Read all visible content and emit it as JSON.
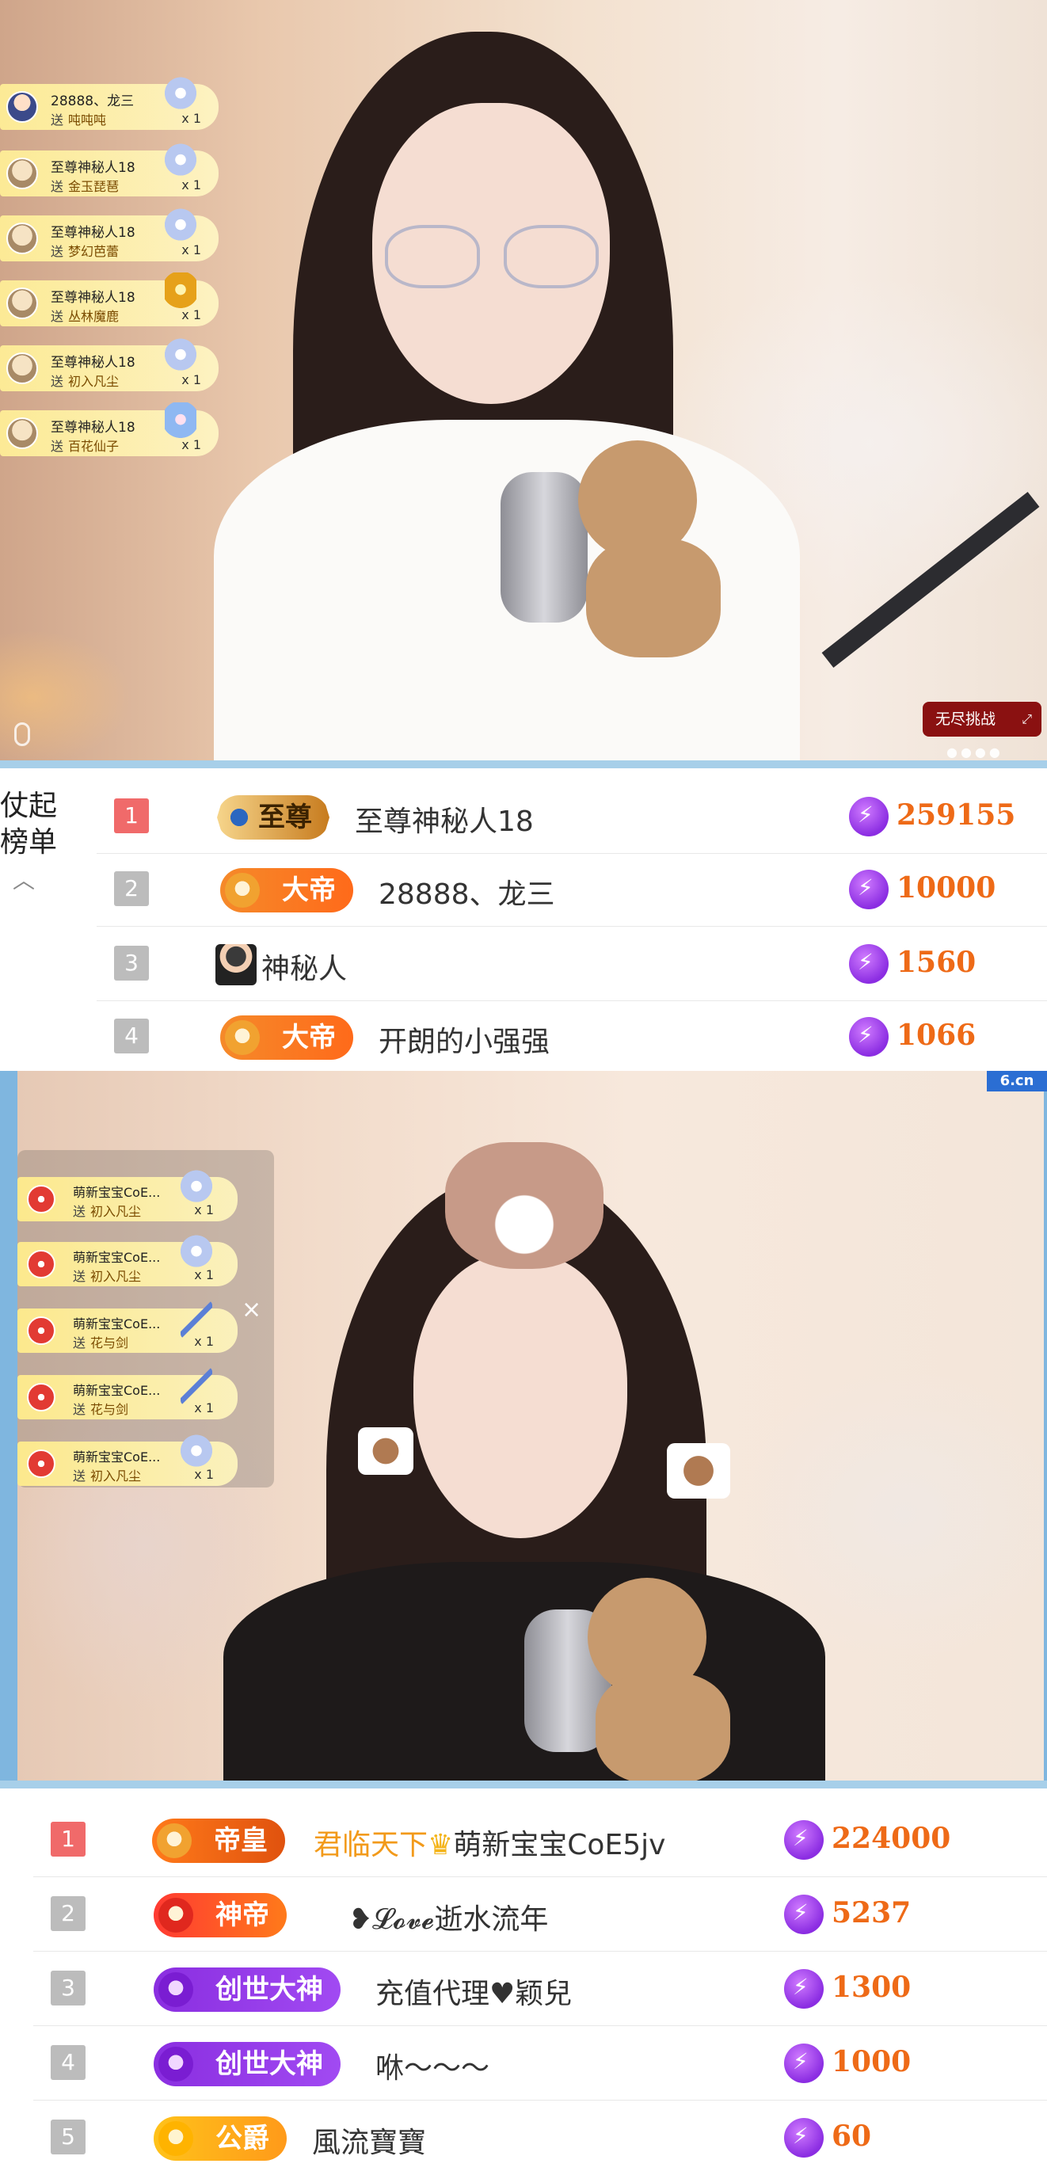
{
  "stream1": {
    "gift_toasts": [
      {
        "user": "28888、龙三",
        "gift": "吨吨吨",
        "count": "x 1",
        "avatar": "user"
      },
      {
        "user": "至尊神秘人18",
        "gift": "金玉琵琶",
        "count": "x 1",
        "avatar": "mask"
      },
      {
        "user": "至尊神秘人18",
        "gift": "梦幻芭蕾",
        "count": "x 1",
        "avatar": "mask"
      },
      {
        "user": "至尊神秘人18",
        "gift": "丛林魔鹿",
        "count": "x 1",
        "avatar": "mask"
      },
      {
        "user": "至尊神秘人18",
        "gift": "初入凡尘",
        "count": "x 1",
        "avatar": "mask"
      },
      {
        "user": "至尊神秘人18",
        "gift": "百花仙子",
        "count": "x 1",
        "avatar": "mask"
      }
    ],
    "send_prefix": "送",
    "challenge_label": "无尽挑战",
    "challenge_icon": "expand-icon"
  },
  "board1": {
    "side_tab": "仗起榜单",
    "side_tab_line1": "仗起",
    "side_tab_line2": "榜单",
    "rows": [
      {
        "rank": "1",
        "badge": "至尊",
        "badge_style": "zhizun",
        "name": "至尊神秘人18",
        "value": "259155"
      },
      {
        "rank": "2",
        "badge": "大帝",
        "badge_style": "dadi",
        "name": "28888、龙三",
        "value": "10000"
      },
      {
        "rank": "3",
        "badge": "",
        "badge_style": "mystery",
        "name": "神秘人",
        "value": "1560"
      },
      {
        "rank": "4",
        "badge": "大帝",
        "badge_style": "dadi",
        "name": "开朗的小强强",
        "value": "1066"
      }
    ]
  },
  "stream2": {
    "site_tag": "6.cn",
    "gift_toasts": [
      {
        "user": "萌新宝宝CoE...",
        "gift": "初入凡尘",
        "count": "x 1"
      },
      {
        "user": "萌新宝宝CoE...",
        "gift": "初入凡尘",
        "count": "x 1"
      },
      {
        "user": "萌新宝宝CoE...",
        "gift": "花与剑",
        "count": "x 1"
      },
      {
        "user": "萌新宝宝CoE...",
        "gift": "花与剑",
        "count": "x 1"
      },
      {
        "user": "萌新宝宝CoE...",
        "gift": "初入凡尘",
        "count": "x 1"
      }
    ],
    "close_label": "×"
  },
  "board2": {
    "rows": [
      {
        "rank": "1",
        "badge": "帝皇",
        "badge_style": "dihuang",
        "prefix": "君临天下",
        "name": "萌新宝宝CoE5jv",
        "value": "224000"
      },
      {
        "rank": "2",
        "badge": "神帝",
        "badge_style": "shendi",
        "prefix": "",
        "name": "❥𝓛𝓸𝓿𝓮逝水流年",
        "value": "5237"
      },
      {
        "rank": "3",
        "badge": "创世大神",
        "badge_style": "chuangshi",
        "prefix": "",
        "name": "充值代理♥颖兒",
        "value": "1300"
      },
      {
        "rank": "4",
        "badge": "创世大神",
        "badge_style": "chuangshi",
        "prefix": "",
        "name": "咻～～～",
        "value": "1000"
      },
      {
        "rank": "5",
        "badge": "公爵",
        "badge_style": "gongjue",
        "prefix": "",
        "name": "風流寶寶",
        "value": "60"
      }
    ]
  }
}
